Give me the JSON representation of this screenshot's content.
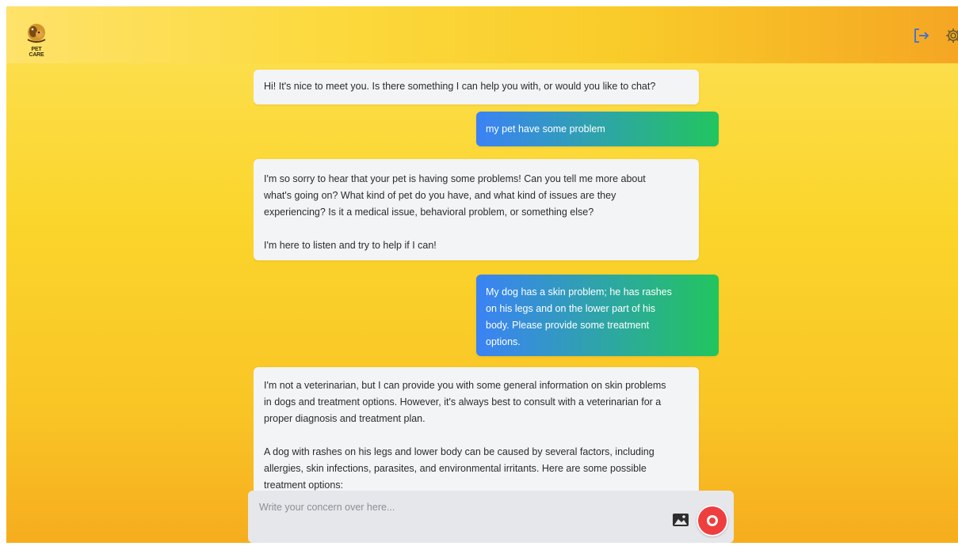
{
  "header": {
    "logo_text": "PET CARE",
    "icons": [
      "logout-icon",
      "settings-icon"
    ]
  },
  "messages": [
    {
      "role": "bot",
      "text": "Hi! It's nice to meet you. Is there something I can help you with, or would you like to chat?"
    },
    {
      "role": "user",
      "text": "my pet have some problem"
    },
    {
      "role": "bot",
      "text": "I'm so sorry to hear that your pet is having some problems! Can you tell me more about\nwhat's going on? What kind of pet do you have, and what kind of issues are they\nexperiencing? Is it a medical issue, behavioral problem, or something else?\n\nI'm here to listen and try to help if I can!"
    },
    {
      "role": "user",
      "text": "My dog has a skin problem; he has rashes\non his legs and on the lower part of his\nbody. Please provide some treatment\noptions."
    },
    {
      "role": "bot",
      "text": "I'm not a veterinarian, but I can provide you with some general information on skin problems\nin dogs and treatment options. However, it's always best to consult with a veterinarian for a\nproper diagnosis and treatment plan.\n\nA dog with rashes on his legs and lower body can be caused by several factors, including\nallergies, skin infections, parasites, and environmental irritants. Here are some possible\ntreatment options:"
    }
  ],
  "composer": {
    "placeholder": "Write your concern over here...",
    "value": ""
  },
  "colors": {
    "user_gradient_start": "#3b82f6",
    "user_gradient_end": "#22c55e",
    "bot_bubble": "#f3f4f6",
    "send_button": "#ee3e3e",
    "background_top": "#fde156",
    "background_bottom": "#f6ad1e"
  }
}
